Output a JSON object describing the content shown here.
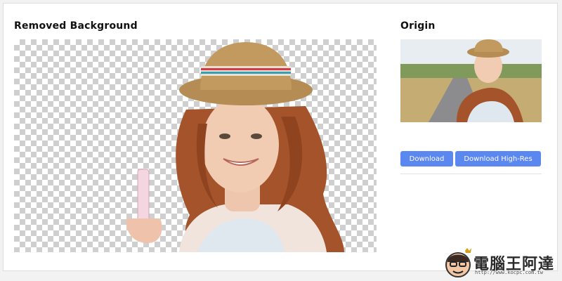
{
  "panel": {
    "removed_title": "Removed Background",
    "origin_title": "Origin"
  },
  "actions": {
    "download_label": "Download",
    "download_hires_label": "Download High-Res"
  },
  "watermark": {
    "title": "電腦王阿達",
    "url": "http://www.kocpc.com.tw"
  },
  "colors": {
    "button": "#5b87f0",
    "checker": "#cfcfcf",
    "hair": "#a5532a",
    "hat": "#b58c54"
  }
}
